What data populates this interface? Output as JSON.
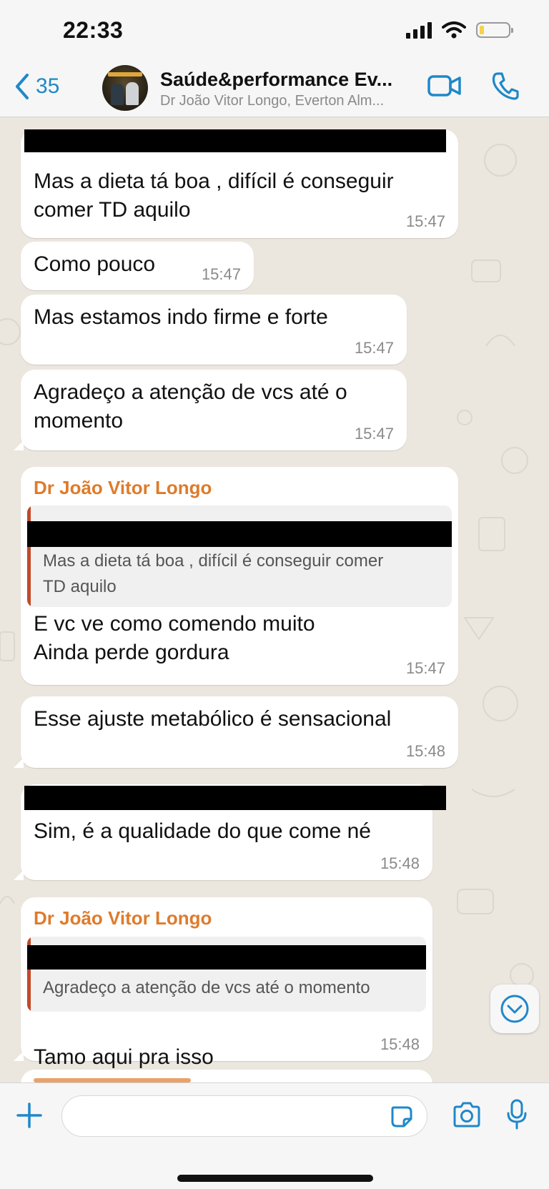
{
  "status_bar": {
    "time": "22:33"
  },
  "header": {
    "back_count": "35",
    "title": "Saúde&performance Ev...",
    "subtitle": "Dr João Vitor Longo, Everton Alm..."
  },
  "messages": [
    {
      "text": "Mas a dieta tá boa , difícil é conseguir\ncomer TD aquilo",
      "time": "15:47"
    },
    {
      "text": "Como pouco",
      "time": "15:47"
    },
    {
      "text": "Mas estamos indo firme e forte",
      "time": "15:47"
    },
    {
      "text": "Agradeço a atenção de vcs até o\nmomento",
      "time": "15:47"
    },
    {
      "sender": "Dr João Vitor Longo",
      "quote": "Mas a dieta tá boa , difícil é conseguir comer\nTD aquilo",
      "text": "E vc ve como comendo muito\nAinda perde gordura",
      "time": "15:47"
    },
    {
      "text": "Esse ajuste metabólico é sensacional",
      "time": "15:48"
    },
    {
      "text": "Sim, é a qualidade do que come né",
      "time": "15:48"
    },
    {
      "sender": "Dr João Vitor Longo",
      "quote": "Agradeço a atenção de vcs até o momento",
      "text": "Tamo aqui pra isso",
      "time": "15:48"
    }
  ],
  "colors": {
    "accent": "#1f88c9",
    "sender": "#de7b2b",
    "quote_bar": "#c0492a"
  },
  "icons": [
    "back-chevron-icon",
    "video-call-icon",
    "phone-icon",
    "scroll-down-icon",
    "plus-icon",
    "sticker-icon",
    "camera-icon",
    "microphone-icon"
  ]
}
